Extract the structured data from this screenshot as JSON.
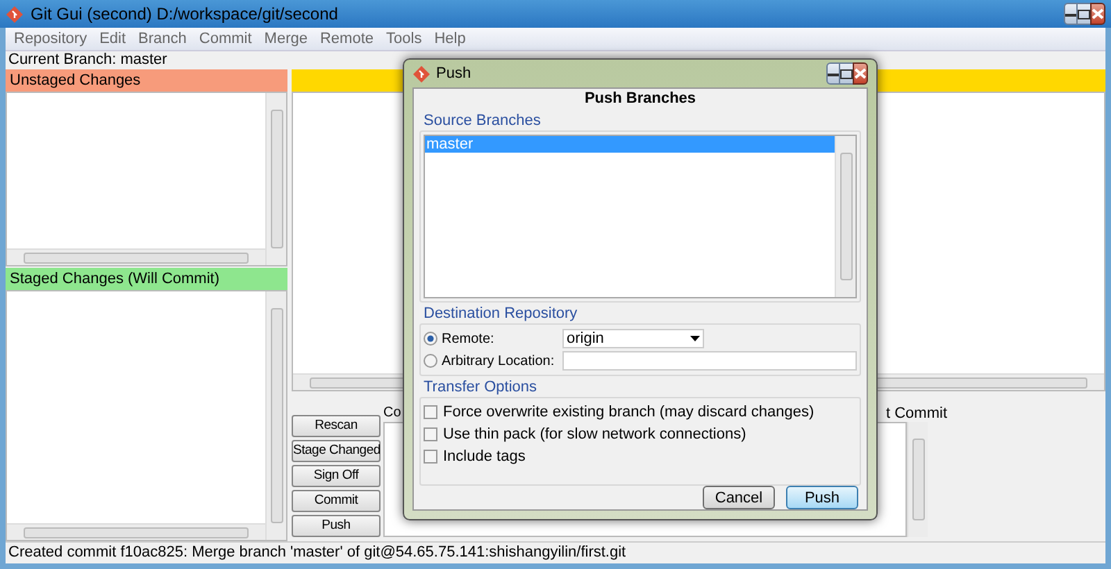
{
  "window": {
    "title": "Git Gui (second) D:/workspace/git/second"
  },
  "menu": [
    "Repository",
    "Edit",
    "Branch",
    "Commit",
    "Merge",
    "Remote",
    "Tools",
    "Help"
  ],
  "current_branch": "Current Branch: master",
  "unstaged": {
    "title": "Unstaged Changes"
  },
  "staged": {
    "title": "Staged Changes (Will Commit)"
  },
  "commit_area": {
    "label_left": "Co",
    "label_right": "t Commit"
  },
  "buttons": [
    "Rescan",
    "Stage Changed",
    "Sign Off",
    "Commit",
    "Push"
  ],
  "status_bar": "Created commit f10ac825: Merge branch 'master' of git@54.65.75.141:shishangyilin/first.git",
  "dialog": {
    "title": "Push",
    "heading": "Push Branches",
    "source": {
      "label": "Source Branches",
      "items": [
        {
          "label": "master",
          "selected": true
        }
      ]
    },
    "destination": {
      "label": "Destination Repository",
      "options": [
        {
          "kind": "dropdown",
          "label": "Remote:",
          "selected": true,
          "value": "origin"
        },
        {
          "kind": "text",
          "label": "Arbitrary Location:",
          "selected": false
        }
      ]
    },
    "transfer": {
      "label": "Transfer Options",
      "options": [
        {
          "label": "Force overwrite existing branch (may discard changes)",
          "checked": false
        },
        {
          "label": "Use thin pack (for slow network connections)",
          "checked": false
        },
        {
          "label": "Include tags",
          "checked": false
        }
      ]
    },
    "buttons": [
      {
        "label": "Cancel",
        "focused": false
      },
      {
        "label": "Push",
        "focused": true
      }
    ]
  }
}
